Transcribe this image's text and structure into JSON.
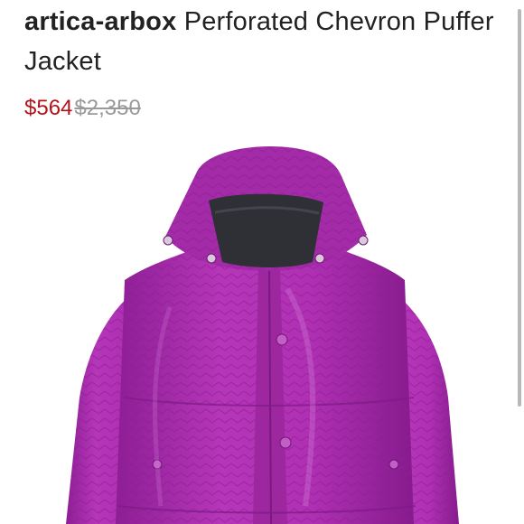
{
  "product": {
    "brand": "artica-arbox",
    "name": "Perforated Chevron Puffer Jacket",
    "sale_price": "$564",
    "original_price": "$2,350",
    "image_alt": "Purple perforated chevron leather puffer jacket"
  },
  "colors": {
    "sale": "#b3121b",
    "jacket": "#a52aa8",
    "lining": "#2f3036"
  }
}
